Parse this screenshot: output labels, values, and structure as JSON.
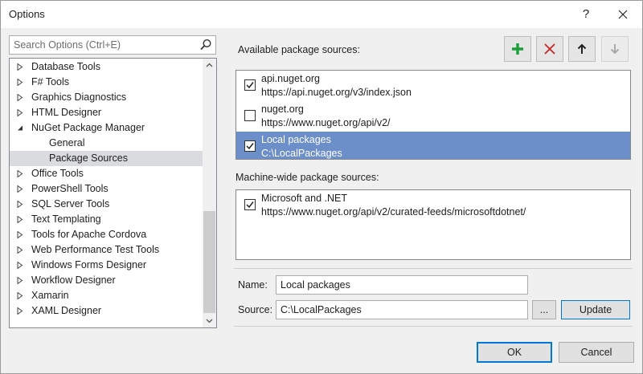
{
  "window": {
    "title": "Options",
    "help_label": "?"
  },
  "search": {
    "placeholder": "Search Options (Ctrl+E)"
  },
  "tree": {
    "items": [
      {
        "label": "Database Tools"
      },
      {
        "label": "F# Tools"
      },
      {
        "label": "Graphics Diagnostics"
      },
      {
        "label": "HTML Designer"
      },
      {
        "label": "NuGet Package Manager",
        "expanded": true
      },
      {
        "label": "General"
      },
      {
        "label": "Package Sources",
        "selected": true
      },
      {
        "label": "Office Tools"
      },
      {
        "label": "PowerShell Tools"
      },
      {
        "label": "SQL Server Tools"
      },
      {
        "label": "Text Templating"
      },
      {
        "label": "Tools for Apache Cordova"
      },
      {
        "label": "Web Performance Test Tools"
      },
      {
        "label": "Windows Forms Designer"
      },
      {
        "label": "Workflow Designer"
      },
      {
        "label": "Xamarin"
      },
      {
        "label": "XAML Designer"
      }
    ]
  },
  "available": {
    "label": "Available package sources:",
    "sources": [
      {
        "name": "api.nuget.org",
        "url": "https://api.nuget.org/v3/index.json",
        "checked": true
      },
      {
        "name": "nuget.org",
        "url": "https://www.nuget.org/api/v2/",
        "checked": false
      },
      {
        "name": "Local packages",
        "url": "C:\\LocalPackages",
        "checked": true,
        "selected": true
      }
    ]
  },
  "toolbar": {
    "add_icon": "plus-icon",
    "remove_icon": "x-icon",
    "up_icon": "arrow-up-icon",
    "down_icon": "arrow-down-icon"
  },
  "machine_wide": {
    "label": "Machine-wide package sources:",
    "sources": [
      {
        "name": "Microsoft and .NET",
        "url": "https://www.nuget.org/api/v2/curated-feeds/microsoftdotnet/",
        "checked": true
      }
    ]
  },
  "form": {
    "name_label": "Name:",
    "name_value": "Local packages",
    "source_label": "Source:",
    "source_value": "C:\\LocalPackages",
    "browse_label": "...",
    "update_label": "Update"
  },
  "dialog": {
    "ok_label": "OK",
    "cancel_label": "Cancel"
  },
  "colors": {
    "selection": "#6c8ec9",
    "add_green": "#1e9e3a",
    "remove_red": "#c62828"
  }
}
